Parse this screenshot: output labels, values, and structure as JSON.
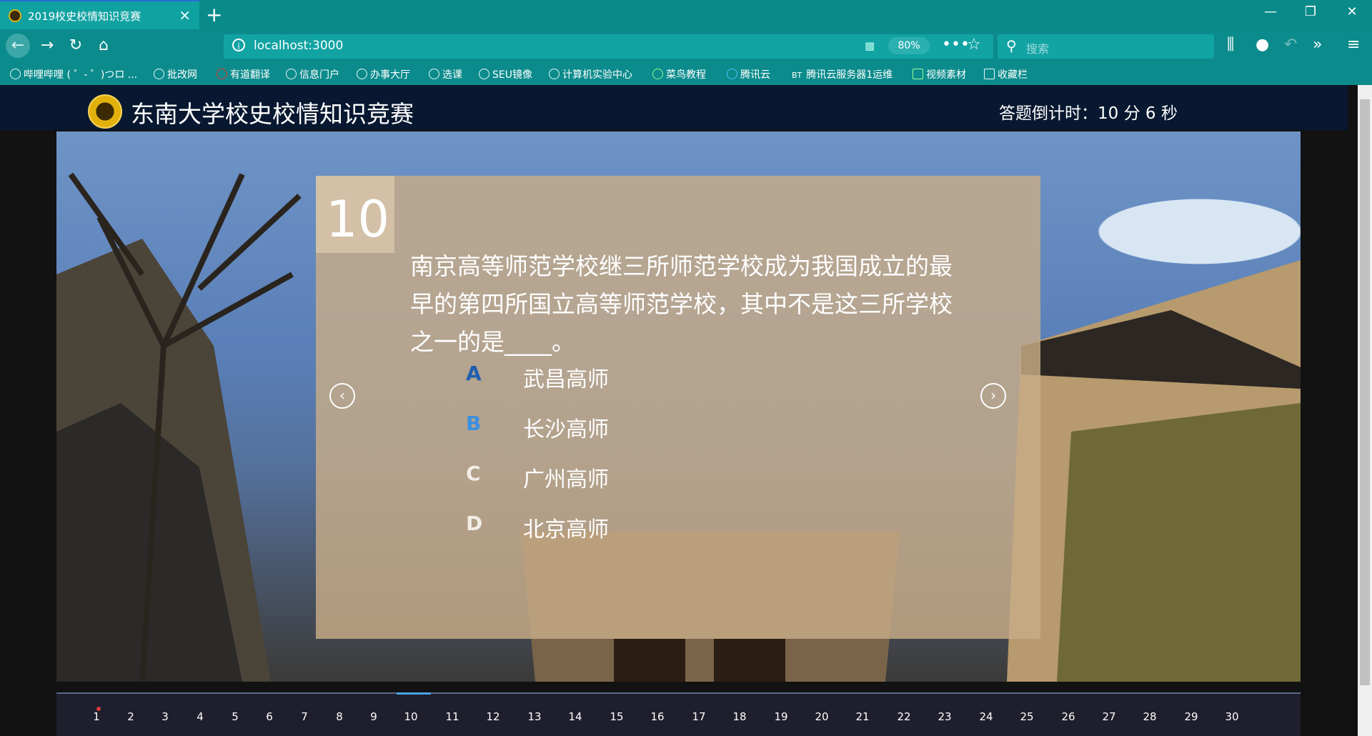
{
  "browser": {
    "tab_title": "2019校史校情知识竞赛",
    "new_tab": "+",
    "url": "localhost:3000",
    "zoom": "80%",
    "search_placeholder": "搜索",
    "bookmarks": [
      {
        "label": "哔哩哔哩 ( ゜- ゜)つロ ...",
        "icon": "bilibili-icon"
      },
      {
        "label": "批改网",
        "icon": "cloud-icon"
      },
      {
        "label": "有道翻译",
        "icon": "youdao-icon"
      },
      {
        "label": "信息门户",
        "icon": "globe-icon"
      },
      {
        "label": "办事大厅",
        "icon": "globe-icon"
      },
      {
        "label": "选课",
        "icon": "globe-icon"
      },
      {
        "label": "SEU镜像",
        "icon": "globe-icon"
      },
      {
        "label": "计算机实验中心",
        "icon": "globe-icon"
      },
      {
        "label": "菜鸟教程",
        "icon": "runoob-icon"
      },
      {
        "label": "腾讯云",
        "icon": "tencent-cloud-icon"
      },
      {
        "label": "腾讯云服务器1运维",
        "icon": "bt-icon"
      },
      {
        "label": "视频素材",
        "icon": "image-icon"
      },
      {
        "label": "收藏栏",
        "icon": "folder-icon"
      }
    ]
  },
  "page": {
    "site_title": "东南大学校史校情知识竞赛",
    "countdown": "答题倒计时：10 分 6 秒",
    "question": {
      "number": "10",
      "text": "南京高等师范学校继三所师范学校成为我国成立的最早的第四所国立高等师范学校，其中不是这三所学校之一的是____。",
      "options": [
        {
          "letter": "A",
          "text": "武昌高师",
          "letter_color": "#1f5fb0"
        },
        {
          "letter": "B",
          "text": "长沙高师",
          "letter_color": "#3a8fe0"
        },
        {
          "letter": "C",
          "text": "广州高师",
          "letter_color": "#f2ede6"
        },
        {
          "letter": "D",
          "text": "北京高师",
          "letter_color": "#f2ede6"
        }
      ]
    },
    "prev_arrow": "‹",
    "next_arrow": "›",
    "question_nav": [
      "1",
      "2",
      "3",
      "4",
      "5",
      "6",
      "7",
      "8",
      "9",
      "10",
      "11",
      "12",
      "13",
      "14",
      "15",
      "16",
      "17",
      "18",
      "19",
      "20",
      "21",
      "22",
      "23",
      "24",
      "25",
      "26",
      "27",
      "28",
      "29",
      "30"
    ],
    "active_question": "10",
    "flagged_question": "1"
  },
  "colors": {
    "chrome": "#0c8b8c",
    "header": "#081830",
    "card": "#c8ac88",
    "active_indicator": "#4aa3e6"
  }
}
